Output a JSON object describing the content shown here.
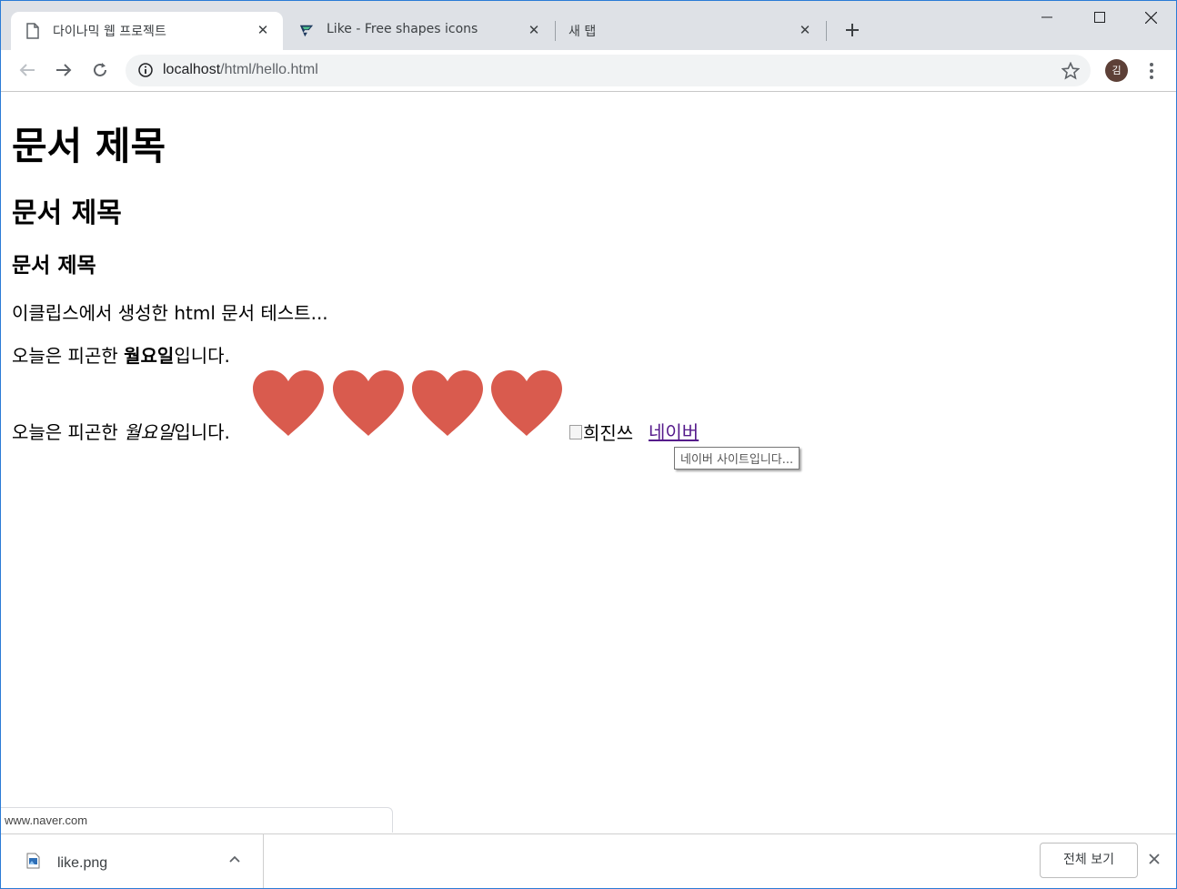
{
  "browser": {
    "tabs": [
      {
        "title": "다이나믹 웹 프로젝트",
        "icon": "document-icon",
        "active": true
      },
      {
        "title": "Like - Free shapes icons",
        "icon": "flaticon-logo-icon",
        "active": false
      },
      {
        "title": "새 탭",
        "icon": "",
        "active": false
      }
    ],
    "address": {
      "host": "localhost",
      "path": "/html/hello.html"
    },
    "avatar_initial": "김",
    "accent": "#dee1e6"
  },
  "page": {
    "h1": "문서 제목",
    "h2": "문서 제목",
    "h3": "문서 제목",
    "p1": "이클립스에서 생성한 html 문서 테스트...",
    "p2_prefix": "오늘은 피곤한 ",
    "p2_bold": "월요일",
    "p2_suffix": "입니다.",
    "p3_prefix": "오늘은 피곤한 ",
    "p3_italic": "월요일",
    "p3_suffix": "입니다.",
    "heart_color": "#d95b4e",
    "heart_count": 4,
    "img_alt": "희진쓰",
    "link_text": "네이버",
    "link_tooltip": "네이버 사이트입니다...",
    "status_url": "www.naver.com"
  },
  "downloads": {
    "file_name": "like.png",
    "show_all": "전체 보기"
  }
}
